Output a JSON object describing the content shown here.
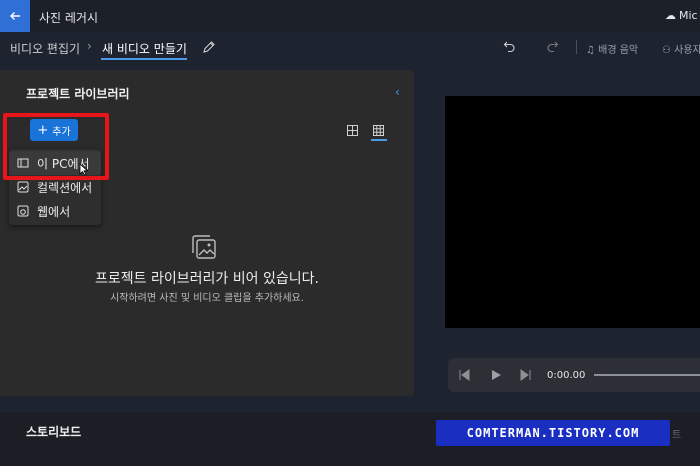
{
  "titlebar": {
    "back_icon": "arrow-left-icon",
    "app_title": "사진 레거시",
    "account_label": "Mic",
    "accent": "#2f6fd6"
  },
  "breadcrumb": {
    "parent": "비디오 편집기",
    "separator": "›",
    "current": "새 비디오 만들기"
  },
  "toolbar": {
    "music_label": "배경 음악",
    "user_label": "사용자"
  },
  "library": {
    "title": "프로젝트 라이브러리",
    "add_label": "추가",
    "add_menu": [
      {
        "label": "이 PC에서",
        "icon": "pc-folder-icon"
      },
      {
        "label": "컬렉션에서",
        "icon": "collection-icon"
      },
      {
        "label": "웹에서",
        "icon": "web-icon"
      }
    ],
    "empty_title": "프로젝트 라이브러리가 비어 있습니다.",
    "empty_subtitle": "시작하려면 사진 및 비디오 클립을 추가하세요."
  },
  "player": {
    "time": "0:00.00"
  },
  "storyboard": {
    "title": "스토리보드",
    "watermark": "COMTERMAN.TISTORY.COM",
    "faded_text": "트"
  },
  "colors": {
    "highlight": "#e8161b",
    "add_button": "#1a73d8",
    "panel": "#2b2b2b"
  }
}
